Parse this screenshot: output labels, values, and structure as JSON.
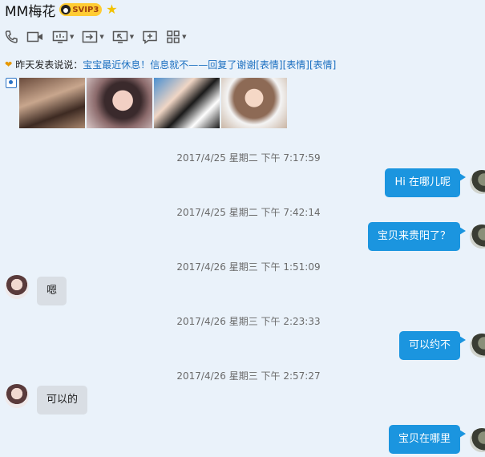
{
  "contact": {
    "name": "MM梅花",
    "vip_badge": "SVIP3"
  },
  "toolbar": {
    "icons": [
      "phone-icon",
      "video-icon",
      "screen-share-icon",
      "remote-assist-icon",
      "remote-desktop-icon",
      "add-chat-icon",
      "apps-icon"
    ]
  },
  "status": {
    "label": "昨天发表说说：",
    "text": "宝宝最近休息！信息就不——回复了谢谢[表情][表情][表情]"
  },
  "photos": {
    "count": 4
  },
  "messages": [
    {
      "time": "2017/4/25 星期二 下午 7:17:59",
      "side": "out",
      "text": "Hi  在哪儿呢"
    },
    {
      "time": "2017/4/25 星期二 下午 7:42:14",
      "side": "out",
      "text": "宝贝来贵阳了？"
    },
    {
      "time": "2017/4/26 星期三 下午 1:51:09",
      "side": "in",
      "text": "嗯"
    },
    {
      "time": "2017/4/26 星期三 下午 2:23:33",
      "side": "out",
      "text": "可以约不"
    },
    {
      "time": "2017/4/26 星期三 下午 2:57:27",
      "side": "in",
      "text": "可以的"
    },
    {
      "time": "",
      "side": "out",
      "text": "宝贝在哪里"
    }
  ],
  "colors": {
    "background": "#eaf2fa",
    "outgoing_bubble": "#1b95df",
    "incoming_bubble": "#d9dee4",
    "link_text": "#1b6fc0"
  }
}
